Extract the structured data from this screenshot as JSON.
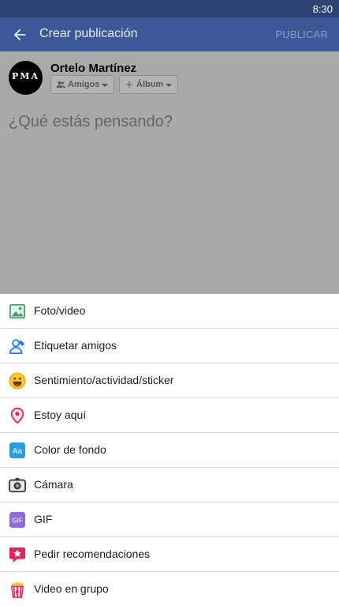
{
  "status_bar": {
    "time": "8:30"
  },
  "app_bar": {
    "title": "Crear publicación",
    "publish_label": "PUBLICAR"
  },
  "composer": {
    "user_name": "Ortelo Martínez",
    "avatar_logo": "PMA",
    "privacy_label": "Amigos",
    "album_label": "Álbum",
    "placeholder": "¿Qué estás pensando?"
  },
  "menu": {
    "items": [
      {
        "label": "Foto/video",
        "icon": "photo-icon"
      },
      {
        "label": "Etiquetar amigos",
        "icon": "tag-friends-icon"
      },
      {
        "label": "Sentimiento/actividad/sticker",
        "icon": "smiley-icon"
      },
      {
        "label": "Estoy aquí",
        "icon": "location-pin-icon"
      },
      {
        "label": "Color de fondo",
        "icon": "text-color-icon"
      },
      {
        "label": "Cámara",
        "icon": "camera-icon"
      },
      {
        "label": "GIF",
        "icon": "gif-icon"
      },
      {
        "label": "Pedir recomendaciones",
        "icon": "recommendation-icon"
      },
      {
        "label": "Video en grupo",
        "icon": "popcorn-icon"
      }
    ]
  },
  "colors": {
    "appbar": "#3b5998",
    "statusbar": "#2d4373",
    "overlay": "#a9a9a9"
  }
}
